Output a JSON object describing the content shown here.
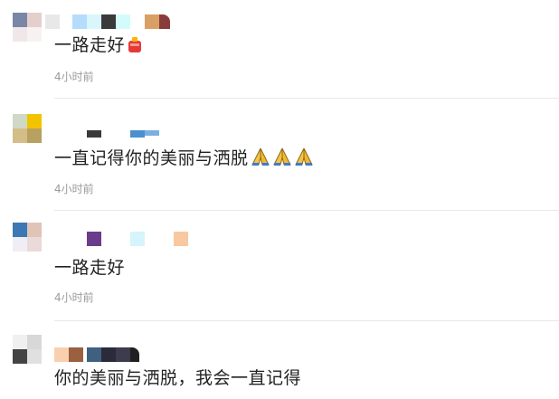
{
  "comments": [
    {
      "text": "一路走好",
      "time": "4小时前",
      "reaction": "fire-cracker-icon"
    },
    {
      "text": "一直记得你的美丽与洒脱",
      "time": "4小时前",
      "reaction": "folded-hands-icon"
    },
    {
      "text": "一路走好",
      "time": "4小时前"
    },
    {
      "text": "你的美丽与洒脱，我会一直记得"
    }
  ],
  "colors": {
    "text": "#222222",
    "time": "#9a9a9a",
    "divider": "#e8e8e8"
  }
}
